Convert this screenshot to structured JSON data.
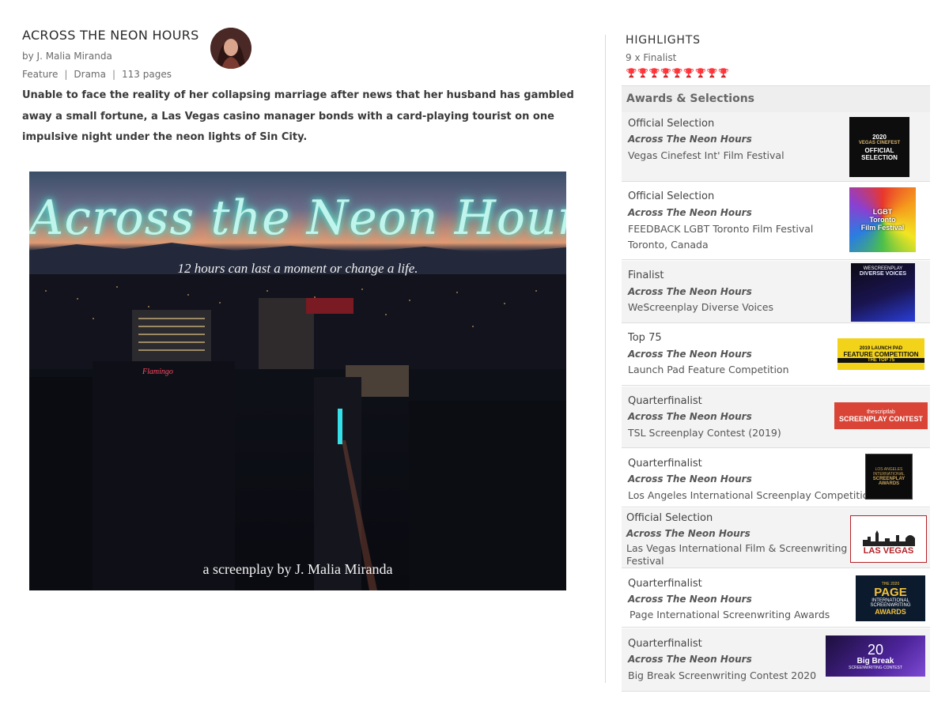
{
  "screenplay": {
    "title": "ACROSS THE NEON HOURS",
    "author": "by J. Malia Miranda",
    "genre_type": "Feature",
    "genre": "Drama",
    "pages": "113 pages",
    "separator": "|",
    "logline": "Unable to face the reality of her collapsing marriage after news that her husband has gambled away a small fortune, a Las Vegas casino manager bonds with a card-playing tourist on one impulsive night under the neon lights of Sin City."
  },
  "poster": {
    "title": "Across the Neon Hours",
    "tagline": "12 hours can last a moment or change a life.",
    "credit": "a screenplay by J. Malia Miranda",
    "sign_text": "Flamingo"
  },
  "highlights": {
    "title": "HIGHLIGHTS",
    "subtitle": "9 x Finalist",
    "trophy_count": 9,
    "trophy_color": "#a8161b"
  },
  "awards_header": "Awards & Selections",
  "awards": [
    {
      "status": "Official Selection",
      "film": "Across The Neon Hours",
      "festival": "Vegas Cinefest Int' Film Festival",
      "logo_lines": [
        "2020",
        "VEGAS CINEFEST",
        "OFFICIAL",
        "SELECTION"
      ]
    },
    {
      "status": "Official Selection",
      "film": "Across The Neon Hours",
      "festival": "FEEDBACK LGBT Toronto Film Festival",
      "location": "Toronto, Canada",
      "logo_lines": [
        "LGBT",
        "Toronto",
        "Film Festival"
      ]
    },
    {
      "status": "Finalist",
      "film": "Across The Neon Hours",
      "festival": "WeScreenplay Diverse Voices",
      "logo_lines": [
        "WESCREENPLAY",
        "DIVERSE VOICES"
      ]
    },
    {
      "status": "Top 75",
      "film": "Across The Neon Hours",
      "festival": "Launch Pad Feature Competition",
      "logo_lines": [
        "2019 LAUNCH PAD",
        "FEATURE COMPETITION",
        "THE TOP 75"
      ]
    },
    {
      "status": "Quarterfinalist",
      "film": "Across The Neon Hours",
      "festival": "TSL Screenplay Contest (2019)",
      "logo_lines": [
        "thescriptlab",
        "SCREENPLAY CONTEST"
      ]
    },
    {
      "status": "Quarterfinalist",
      "film": "Across The Neon Hours",
      "festival": "Los Angeles International Screenplay Competition",
      "logo_lines": [
        "LOS ANGELES",
        "INTERNATIONAL",
        "SCREENPLAY",
        "AWARDS"
      ]
    },
    {
      "status": "Official Selection",
      "film": "Across The Neon Hours",
      "festival": "Las Vegas International Film & Screenwriting Festival",
      "logo_lines": [
        "LAS VEGAS"
      ]
    },
    {
      "status": "Quarterfinalist",
      "film": "Across The Neon Hours",
      "festival": "Page International Screenwriting Awards",
      "logo_lines": [
        "THE 2020",
        "PAGE",
        "INTERNATIONAL",
        "SCREENWRITING",
        "AWARDS"
      ]
    },
    {
      "status": "Quarterfinalist",
      "film": "Across The Neon Hours",
      "festival": "Big Break Screenwriting Contest 2020",
      "logo_lines": [
        "20",
        "Big Break",
        "SCREENWRITING CONTEST"
      ]
    }
  ]
}
